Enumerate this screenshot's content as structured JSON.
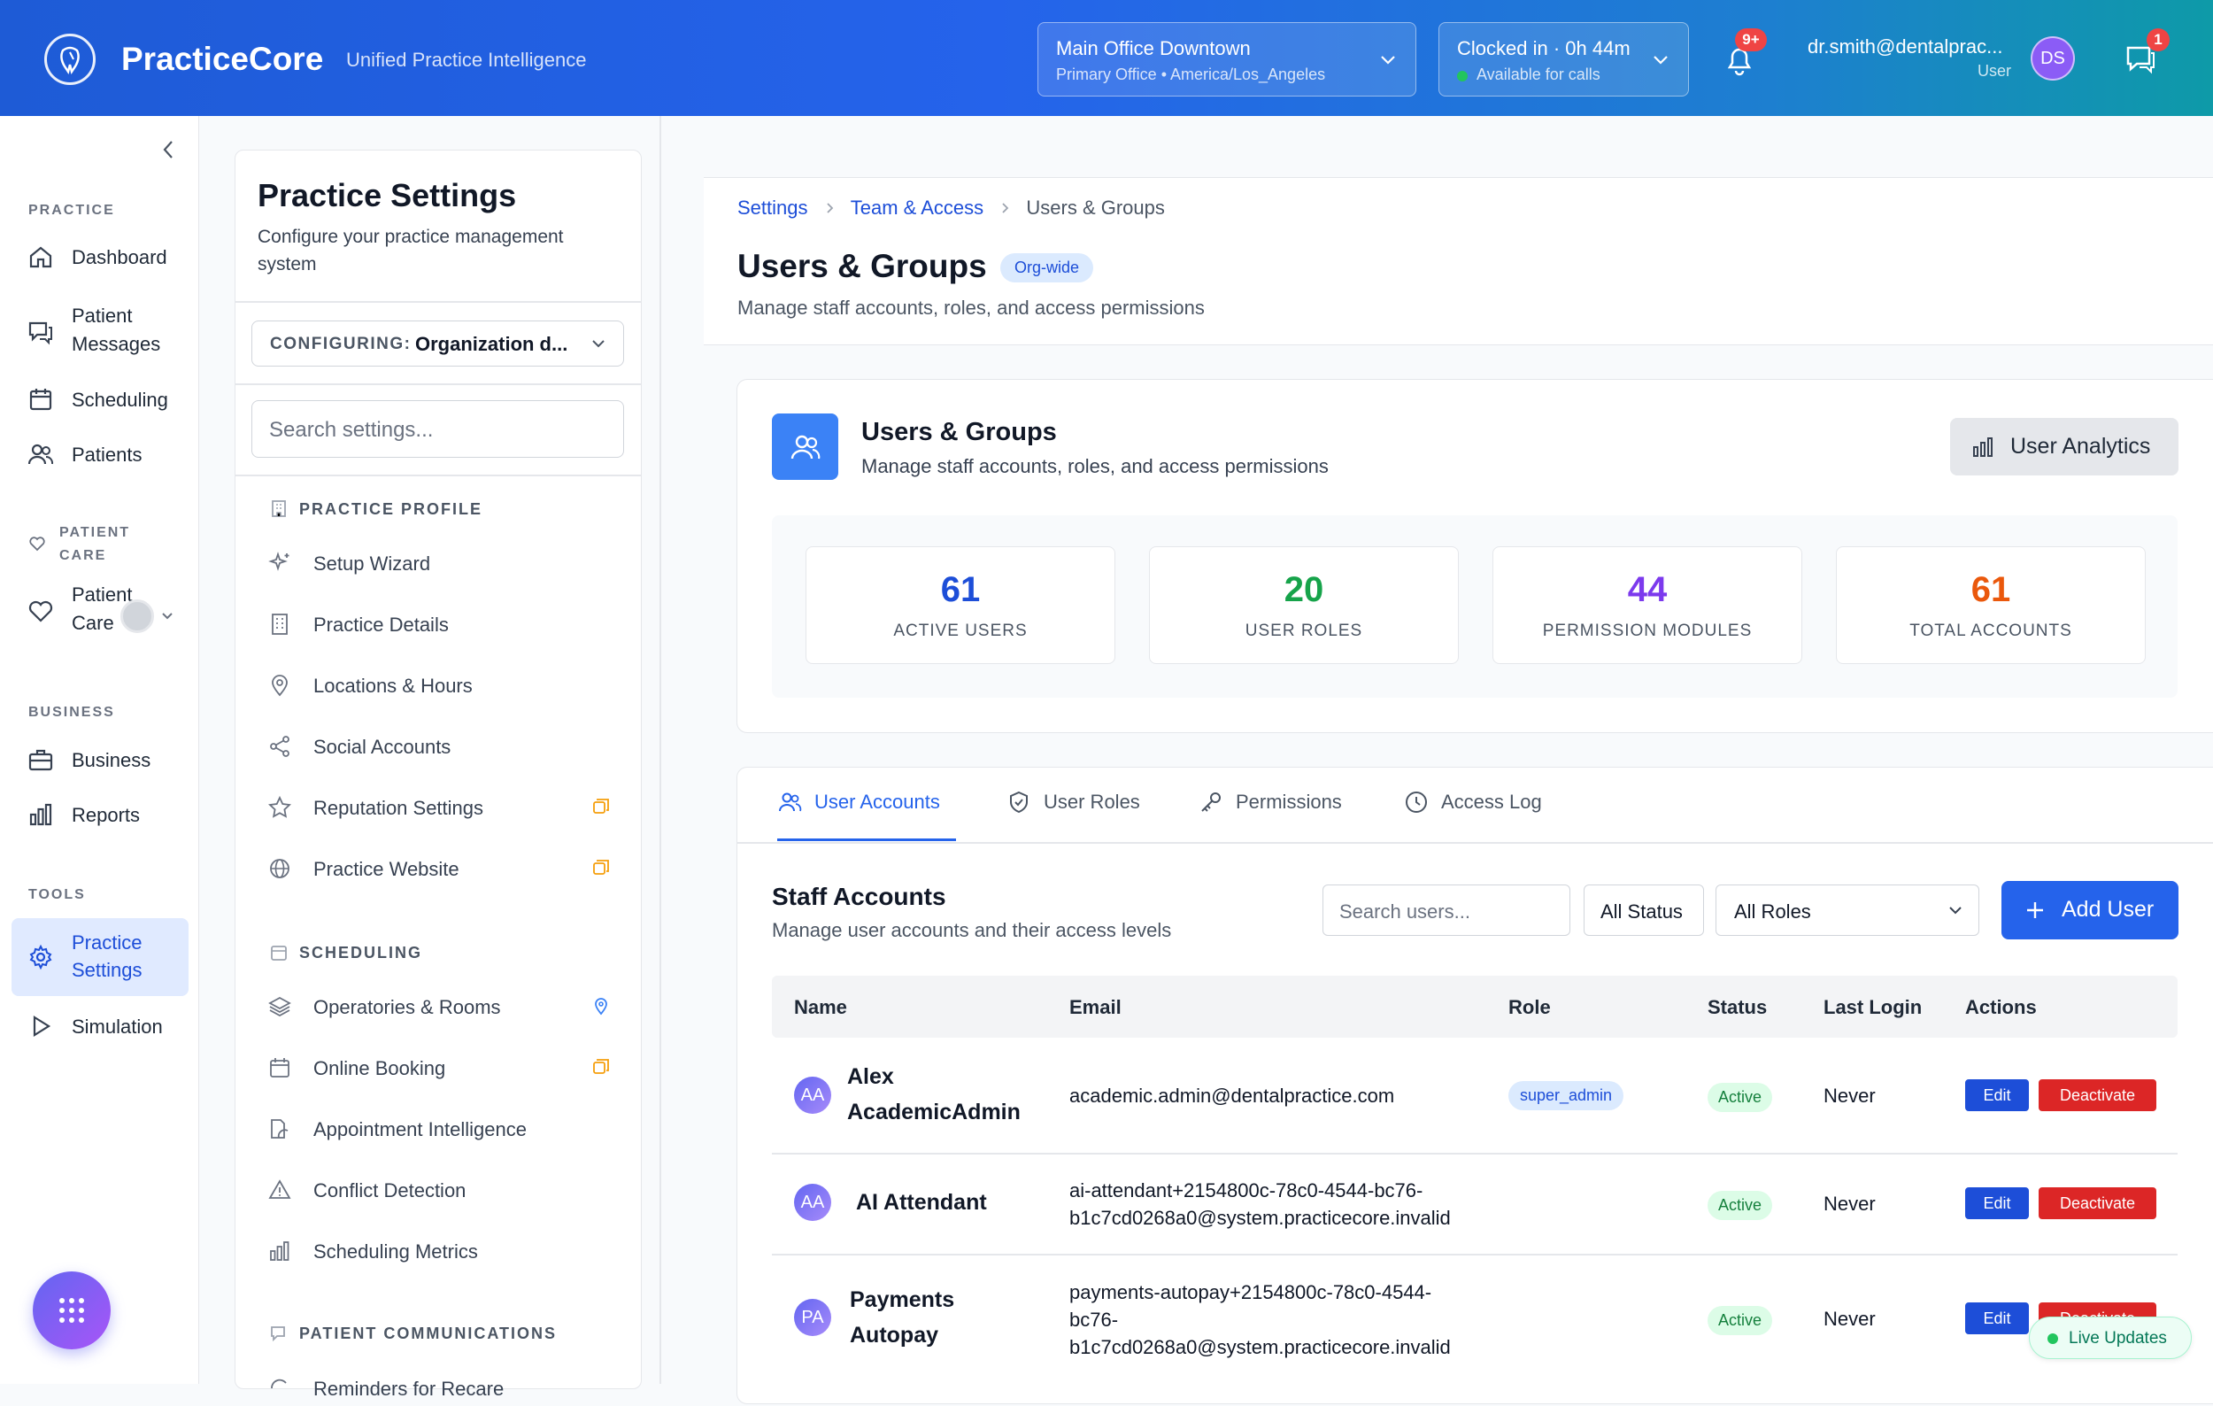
{
  "header": {
    "brand": "PracticeCore",
    "tagline": "Unified Practice Intelligence",
    "location": {
      "name": "Main Office Downtown",
      "detail": "Primary Office • America/Los_Angeles"
    },
    "clock": {
      "status": "Clocked in · 0h 44m",
      "availability": "Available for calls"
    },
    "notifications_badge": "9+",
    "user_email": "dr.smith@dentalprac...",
    "user_role": "User",
    "avatar_initials": "DS",
    "messages_badge": "1"
  },
  "sidebar": {
    "sections": {
      "practice": "PRACTICE",
      "patient_care_1": "PATIENT",
      "patient_care_2": "CARE",
      "business": "BUSINESS",
      "tools": "TOOLS"
    },
    "items": {
      "dashboard": "Dashboard",
      "patient_messages_1": "Patient",
      "patient_messages_2": "Messages",
      "scheduling": "Scheduling",
      "patients": "Patients",
      "patient_care_1": "Patient",
      "patient_care_2": "Care",
      "business": "Business",
      "reports": "Reports",
      "practice_settings_1": "Practice",
      "practice_settings_2": "Settings",
      "simulation": "Simulation"
    }
  },
  "settings_panel": {
    "title": "Practice Settings",
    "subtitle": "Configure your practice management system",
    "configuring_label": "CONFIGURING:",
    "configuring_value": "Organization d...",
    "search_placeholder": "Search settings...",
    "groups": {
      "practice_profile": "PRACTICE PROFILE",
      "scheduling": "SCHEDULING",
      "patient_communications": "PATIENT COMMUNICATIONS"
    },
    "items": {
      "setup_wizard": "Setup Wizard",
      "practice_details": "Practice Details",
      "locations_hours": "Locations & Hours",
      "social_accounts": "Social Accounts",
      "reputation_settings": "Reputation Settings",
      "practice_website": "Practice Website",
      "operatories_rooms": "Operatories & Rooms",
      "online_booking": "Online Booking",
      "appointment_intelligence": "Appointment Intelligence",
      "conflict_detection": "Conflict Detection",
      "scheduling_metrics": "Scheduling Metrics",
      "reminders_partial": "Reminders for Recare"
    }
  },
  "main": {
    "breadcrumb": {
      "settings": "Settings",
      "team_access": "Team & Access",
      "current": "Users & Groups"
    },
    "title": "Users & Groups",
    "scope_badge": "Org-wide",
    "subtitle": "Manage staff accounts, roles, and access permissions",
    "overview": {
      "title": "Users & Groups",
      "subtitle": "Manage staff accounts, roles, and access permissions",
      "analytics_button": "User Analytics",
      "stats": [
        {
          "value": "61",
          "label": "ACTIVE USERS",
          "color": "#1d4ed8"
        },
        {
          "value": "20",
          "label": "USER ROLES",
          "color": "#16a34a"
        },
        {
          "value": "44",
          "label": "PERMISSION MODULES",
          "color": "#7c3aed"
        },
        {
          "value": "61",
          "label": "TOTAL ACCOUNTS",
          "color": "#ea580c"
        }
      ]
    },
    "tabs": {
      "accounts": "User Accounts",
      "roles": "User Roles",
      "permissions": "Permissions",
      "access_log": "Access Log"
    },
    "staff": {
      "title": "Staff Accounts",
      "subtitle": "Manage user accounts and their access levels",
      "search_placeholder": "Search users...",
      "status_filter": "All Status",
      "role_filter": "All Roles",
      "add_button": "Add User"
    },
    "table": {
      "headers": {
        "name": "Name",
        "email": "Email",
        "role": "Role",
        "status": "Status",
        "last_login": "Last Login",
        "actions": "Actions"
      },
      "rows": [
        {
          "initials": "AA",
          "name_1": "Alex",
          "name_2": "AcademicAdmin",
          "email_1": "academic.admin@dentalpractice.com",
          "role": "super_admin",
          "status": "Active",
          "last_login": "Never",
          "edit": "Edit",
          "deactivate": "Deactivate"
        },
        {
          "initials": "AA",
          "name_1": "AI Attendant",
          "email_1": "ai-attendant+2154800c-78c0-4544-bc76-",
          "email_2": "b1c7cd0268a0@system.practicecore.invalid",
          "status": "Active",
          "last_login": "Never",
          "edit": "Edit",
          "deactivate": "Deactivate"
        },
        {
          "initials": "PA",
          "name_1": "Payments",
          "name_2": "Autopay",
          "email_1": "payments-autopay+2154800c-78c0-4544-",
          "email_2": "bc76-",
          "email_3": "b1c7cd0268a0@system.practicecore.invalid",
          "status": "Active",
          "last_login": "Never",
          "edit": "Edit",
          "deactivate": "Deactivate"
        }
      ]
    },
    "live_updates": "Live Updates"
  }
}
